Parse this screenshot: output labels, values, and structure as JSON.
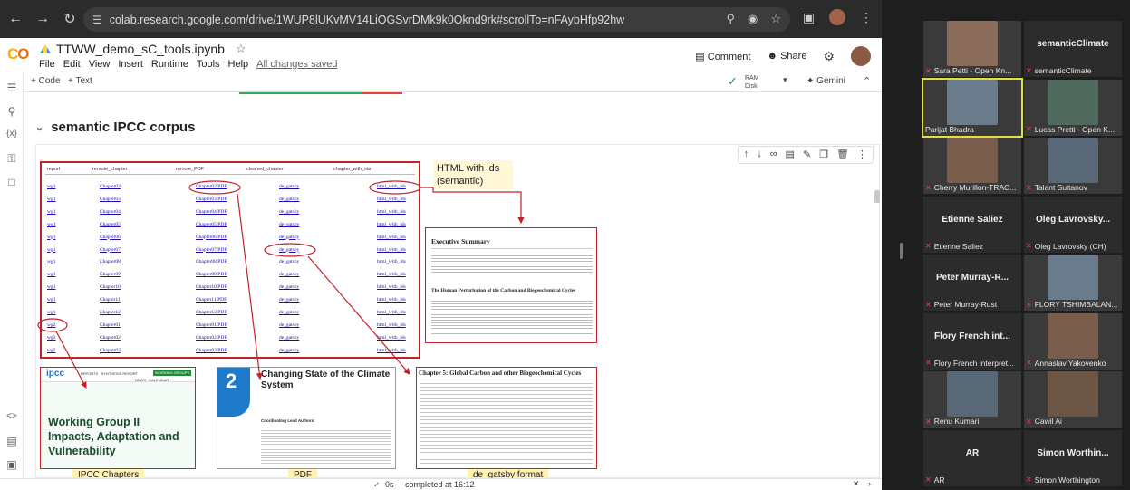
{
  "browser": {
    "url": "colab.research.google.com/drive/1WUP8lUKvMV14LiOGSvrDMk9k0Oknd9rk#scrollTo=nFAybHfp92hw"
  },
  "colab": {
    "notebook_title": "TTWW_demo_sC_tools.ipynb",
    "menu": [
      "File",
      "Edit",
      "View",
      "Insert",
      "Runtime",
      "Tools",
      "Help"
    ],
    "save_status": "All changes saved",
    "comment_label": "Comment",
    "share_label": "Share",
    "add_code": "+ Code",
    "add_text": "+ Text",
    "ram_label": "RAM",
    "disk_label": "Disk",
    "gemini_label": "Gemini",
    "section_title": "semantic IPCC corpus",
    "status_time": "0s",
    "status_text": "completed at 16:12"
  },
  "figure": {
    "table_headers": [
      "report",
      "remote_chapter",
      "remote_PDF",
      "cleaned_chapter",
      "chapter_with_ids"
    ],
    "rows": [
      [
        "wg1",
        "Chapter02",
        "Chapter02.PDF",
        "de_gatsby",
        "html_with_ids"
      ],
      [
        "wg1",
        "Chapter03",
        "Chapter03.PDF",
        "de_gatsby",
        "html_with_ids"
      ],
      [
        "wg1",
        "Chapter04",
        "Chapter04.PDF",
        "de_gatsby",
        "html_with_ids"
      ],
      [
        "wg1",
        "Chapter05",
        "Chapter05.PDF",
        "de_gatsby",
        "html_with_ids"
      ],
      [
        "wg1",
        "Chapter06",
        "Chapter06.PDF",
        "de_gatsby",
        "html_with_ids"
      ],
      [
        "wg1",
        "Chapter07",
        "Chapter07.PDF",
        "de_gatsby",
        "html_with_ids"
      ],
      [
        "wg1",
        "Chapter08",
        "Chapter08.PDF",
        "de_gatsby",
        "html_with_ids"
      ],
      [
        "wg1",
        "Chapter09",
        "Chapter09.PDF",
        "de_gatsby",
        "html_with_ids"
      ],
      [
        "wg1",
        "Chapter10",
        "Chapter10.PDF",
        "de_gatsby",
        "html_with_ids"
      ],
      [
        "wg1",
        "Chapter11",
        "Chapter11.PDF",
        "de_gatsby",
        "html_with_ids"
      ],
      [
        "wg1",
        "Chapter12",
        "Chapter12.PDF",
        "de_gatsby",
        "html_with_ids"
      ],
      [
        "wg2",
        "Chapter01",
        "Chapter01.PDF",
        "de_gatsby",
        "html_with_ids"
      ],
      [
        "wg2",
        "Chapter02",
        "Chapter02.PDF",
        "de_gatsby",
        "html_with_ids"
      ],
      [
        "wg2",
        "Chapter03",
        "Chapter03.PDF",
        "de_gatsby",
        "html_with_ids"
      ]
    ],
    "html_ids_note": "HTML with ids (semantic)",
    "exec_summary_title": "Executive Summary",
    "human_perturbation_title": "The Human Perturbation of the Carbon and Biogeochemical Cycles",
    "ipcc_logo": "ipcc",
    "ipcc_nav": "REPORTS   SYNTHESIS REPORT",
    "ipcc_nav_badge": "WORKING GROUPS",
    "ipcc_nav2": "NEWS   CALENDAR",
    "wg2_title": "Working Group II Impacts, Adaptation and Vulnerability",
    "pdf_chapter_number": "2",
    "pdf_chapter_title": "Changing State of the Climate System",
    "pdf_authors_label": "Coordinating Lead Authors:",
    "chapter5_title": "Chapter 5: Global Carbon and other Biogeochemical Cycles",
    "caption_chapters": "IPCC Chapters",
    "caption_pdf": "PDF",
    "caption_gatsby": "de_gatsby format"
  },
  "participants": [
    {
      "name": "Sara Petti - Open Kn...",
      "muted": true,
      "video": true,
      "big": ""
    },
    {
      "name": "semanticClimate",
      "muted": true,
      "video": false,
      "big": "semanticClimate"
    },
    {
      "name": "Parijat Bhadra",
      "muted": false,
      "video": true,
      "big": ""
    },
    {
      "name": "Lucas Pretti - Open K...",
      "muted": true,
      "video": true,
      "big": ""
    },
    {
      "name": "Cherry Murillon-TRAC...",
      "muted": true,
      "video": true,
      "big": ""
    },
    {
      "name": "Talant Sultanov",
      "muted": true,
      "video": true,
      "big": ""
    },
    {
      "name": "Etienne Saliez",
      "muted": true,
      "video": false,
      "big": "Etienne Saliez"
    },
    {
      "name": "Oleg Lavrovsky (CH)",
      "muted": true,
      "video": false,
      "big": "Oleg Lavrovsky..."
    },
    {
      "name": "Peter Murray-Rust",
      "muted": true,
      "video": false,
      "big": "Peter Murray-R..."
    },
    {
      "name": "FLORY TSHIMBALAN...",
      "muted": true,
      "video": true,
      "big": ""
    },
    {
      "name": "Flory French interpret...",
      "muted": true,
      "video": false,
      "big": "Flory French int..."
    },
    {
      "name": "Annaslav Yakovenko",
      "muted": true,
      "video": true,
      "big": ""
    },
    {
      "name": "Renu Kumari",
      "muted": true,
      "video": true,
      "big": ""
    },
    {
      "name": "Cawil Ai",
      "muted": true,
      "video": true,
      "big": ""
    },
    {
      "name": "AR",
      "muted": true,
      "video": false,
      "big": "AR"
    },
    {
      "name": "Simon Worthington",
      "muted": true,
      "video": false,
      "big": "Simon Worthin..."
    }
  ],
  "colors": {
    "annotation_red": "#c2232a",
    "highlight_yellow": "#e0e040",
    "colab_orange": "#f9ab00"
  }
}
